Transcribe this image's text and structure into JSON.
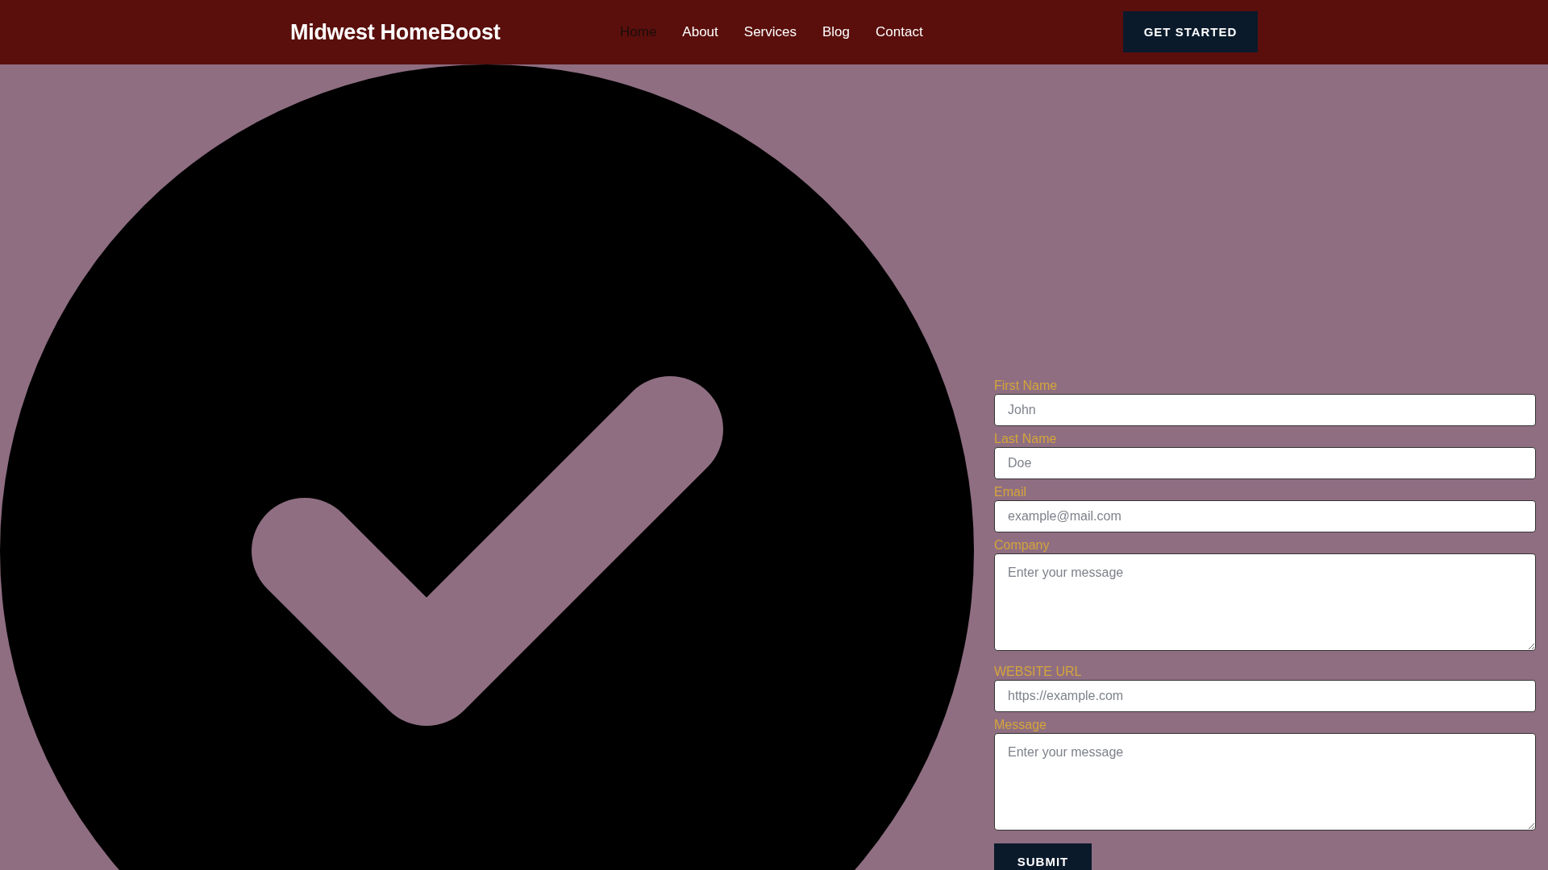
{
  "header": {
    "logo": "Midwest HomeBoost",
    "nav": [
      {
        "label": "Home",
        "selected": true
      },
      {
        "label": "About",
        "selected": false
      },
      {
        "label": "Services",
        "selected": false
      },
      {
        "label": "Blog",
        "selected": false
      },
      {
        "label": "Contact",
        "selected": false
      }
    ],
    "cta": "GET STARTED"
  },
  "form": {
    "fields": [
      {
        "label": "First Name",
        "kind": "input",
        "placeholder": "John"
      },
      {
        "label": "Last Name",
        "kind": "input",
        "placeholder": "Doe"
      },
      {
        "label": "Email",
        "kind": "input",
        "placeholder": "example@mail.com"
      },
      {
        "label": "Company",
        "kind": "textarea",
        "placeholder": "Enter your message"
      },
      {
        "label": "WEBSITE URL",
        "kind": "input",
        "placeholder": "https://example.com"
      },
      {
        "label": "Message",
        "kind": "textarea",
        "placeholder": "Enter your message"
      }
    ],
    "submit": "SUBMIT"
  }
}
